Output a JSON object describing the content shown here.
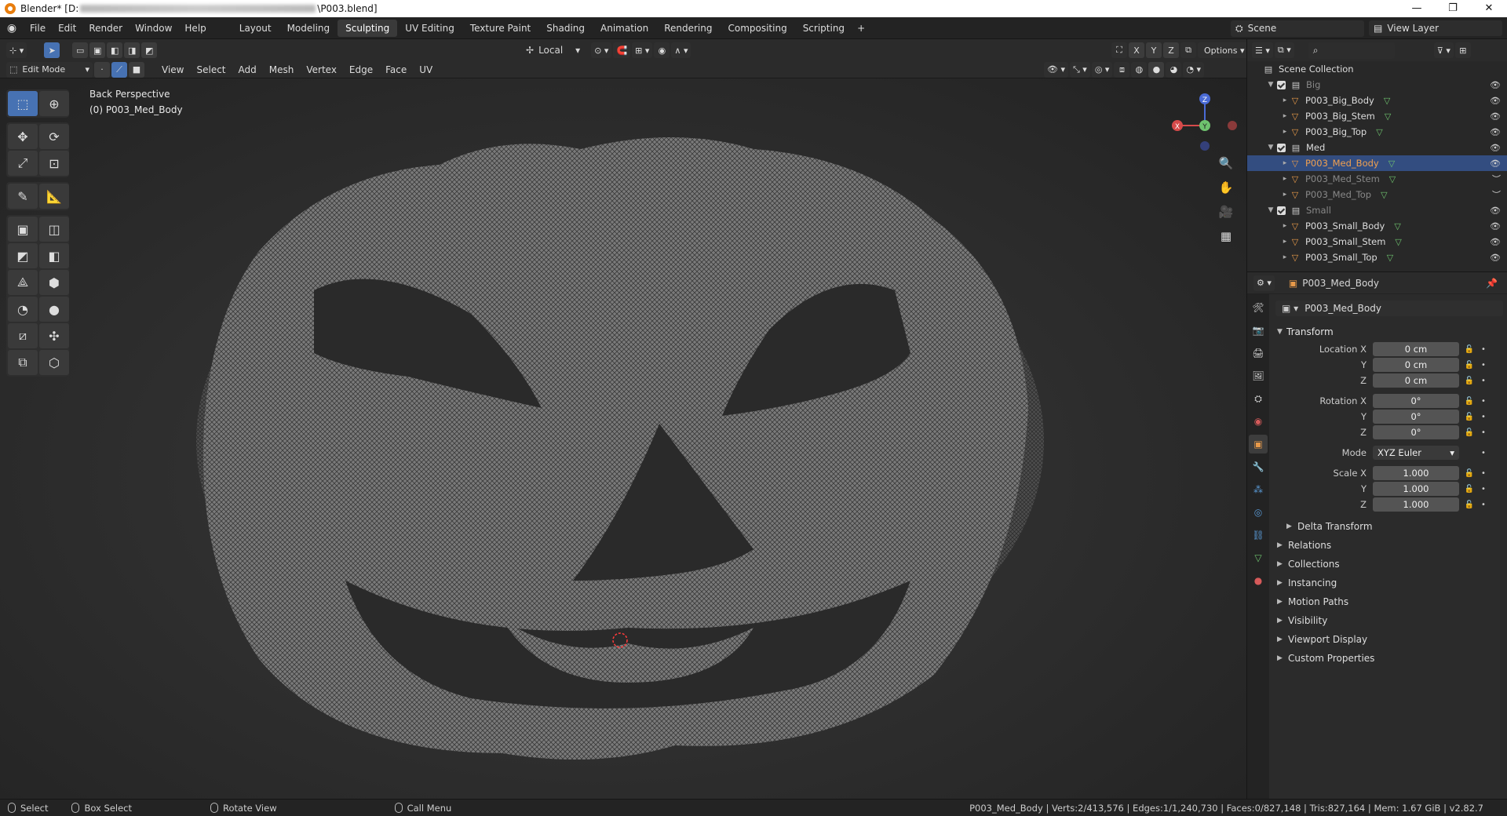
{
  "window": {
    "title_prefix": "Blender* [D:",
    "title_suffix": "\\P003.blend]",
    "min": "—",
    "max": "❐",
    "close": "✕"
  },
  "menu": [
    "File",
    "Edit",
    "Render",
    "Window",
    "Help"
  ],
  "workspaces": [
    "Layout",
    "Modeling",
    "Sculpting",
    "UV Editing",
    "Texture Paint",
    "Shading",
    "Animation",
    "Rendering",
    "Compositing",
    "Scripting"
  ],
  "active_workspace": "Sculpting",
  "scene": {
    "scene_label": "Scene",
    "view_layer": "View Layer"
  },
  "header1": {
    "orientation": "Local",
    "options": "Options",
    "axes": [
      "X",
      "Y",
      "Z"
    ]
  },
  "header2": {
    "mode": "Edit Mode",
    "menus": [
      "View",
      "Select",
      "Add",
      "Mesh",
      "Vertex",
      "Edge",
      "Face",
      "UV"
    ]
  },
  "viewport": {
    "perspective": "Back Perspective",
    "object": "(0) P003_Med_Body",
    "gizmo": {
      "x": "X",
      "y": "Y",
      "z": "Z"
    }
  },
  "outliner": {
    "root": "Scene Collection",
    "rows": [
      {
        "label": "Big",
        "kind": "collection",
        "depth": 0,
        "dim": true
      },
      {
        "label": "P003_Big_Body",
        "kind": "mesh",
        "depth": 1
      },
      {
        "label": "P003_Big_Stem",
        "kind": "mesh",
        "depth": 1
      },
      {
        "label": "P003_Big_Top",
        "kind": "mesh",
        "depth": 1
      },
      {
        "label": "Med",
        "kind": "collection",
        "depth": 0
      },
      {
        "label": "P003_Med_Body",
        "kind": "mesh",
        "depth": 1,
        "selected": true
      },
      {
        "label": "P003_Med_Stem",
        "kind": "mesh",
        "depth": 1,
        "dim": true
      },
      {
        "label": "P003_Med_Top",
        "kind": "mesh",
        "depth": 1,
        "dim": true
      },
      {
        "label": "Small",
        "kind": "collection",
        "depth": 0,
        "dim": true
      },
      {
        "label": "P003_Small_Body",
        "kind": "mesh",
        "depth": 1
      },
      {
        "label": "P003_Small_Stem",
        "kind": "mesh",
        "depth": 1
      },
      {
        "label": "P003_Small_Top",
        "kind": "mesh",
        "depth": 1
      }
    ]
  },
  "properties": {
    "header_object": "P003_Med_Body",
    "name_field": "P003_Med_Body",
    "transform_title": "Transform",
    "location": {
      "label": "Location X",
      "y": "Y",
      "z": "Z",
      "x_val": "0 cm",
      "y_val": "0 cm",
      "z_val": "0 cm"
    },
    "rotation": {
      "label": "Rotation X",
      "y": "Y",
      "z": "Z",
      "x_val": "0°",
      "y_val": "0°",
      "z_val": "0°"
    },
    "mode": {
      "label": "Mode",
      "value": "XYZ Euler"
    },
    "scale": {
      "label": "Scale X",
      "y": "Y",
      "z": "Z",
      "x_val": "1.000",
      "y_val": "1.000",
      "z_val": "1.000"
    },
    "delta": "Delta Transform",
    "sections": [
      "Relations",
      "Collections",
      "Instancing",
      "Motion Paths",
      "Visibility",
      "Viewport Display",
      "Custom Properties"
    ]
  },
  "status": {
    "select": "Select",
    "box_select": "Box Select",
    "rotate": "Rotate View",
    "call_menu": "Call Menu",
    "stats": "P003_Med_Body | Verts:2/413,576 | Edges:1/1,240,730 | Faces:0/827,148 | Tris:827,164 | Mem: 1.67 GiB | v2.82.7"
  }
}
